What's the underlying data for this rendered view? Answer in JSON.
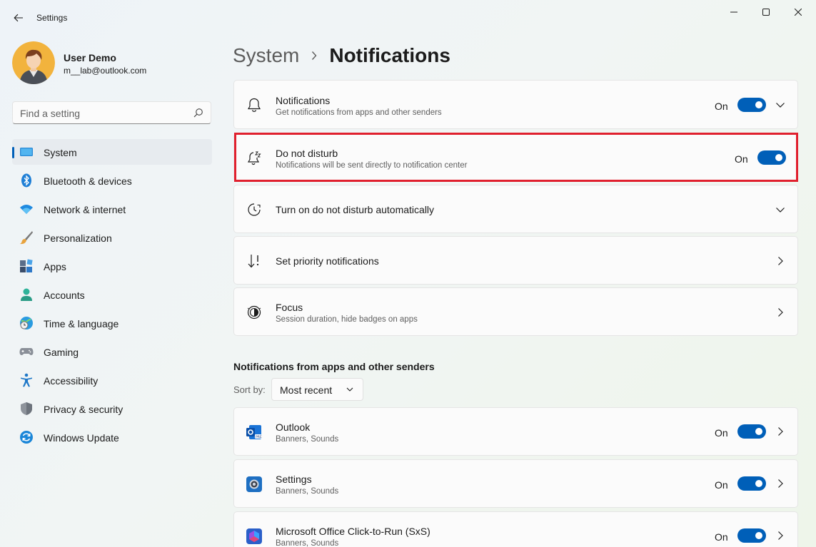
{
  "window": {
    "title": "Settings"
  },
  "profile": {
    "name": "User Demo",
    "email": "m__lab@outlook.com"
  },
  "search": {
    "placeholder": "Find a setting"
  },
  "sidebar": {
    "items": [
      {
        "label": "System",
        "icon": "system-icon",
        "selected": true
      },
      {
        "label": "Bluetooth & devices",
        "icon": "bluetooth-icon"
      },
      {
        "label": "Network & internet",
        "icon": "wifi-icon"
      },
      {
        "label": "Personalization",
        "icon": "brush-icon"
      },
      {
        "label": "Apps",
        "icon": "apps-icon"
      },
      {
        "label": "Accounts",
        "icon": "account-icon"
      },
      {
        "label": "Time & language",
        "icon": "globe-clock-icon"
      },
      {
        "label": "Gaming",
        "icon": "gamepad-icon"
      },
      {
        "label": "Accessibility",
        "icon": "accessibility-icon"
      },
      {
        "label": "Privacy & security",
        "icon": "shield-icon"
      },
      {
        "label": "Windows Update",
        "icon": "update-icon"
      }
    ]
  },
  "breadcrumb": {
    "parent": "System",
    "current": "Notifications"
  },
  "settings": {
    "notifications": {
      "title": "Notifications",
      "subtitle": "Get notifications from apps and other senders",
      "state": "On"
    },
    "dnd": {
      "title": "Do not disturb",
      "subtitle": "Notifications will be sent directly to notification center",
      "state": "On"
    },
    "dnd_auto": {
      "title": "Turn on do not disturb automatically"
    },
    "priority": {
      "title": "Set priority notifications"
    },
    "focus": {
      "title": "Focus",
      "subtitle": "Session duration, hide badges on apps"
    }
  },
  "apps_section": {
    "title": "Notifications from apps and other senders",
    "sort_label": "Sort by:",
    "sort_value": "Most recent",
    "apps": [
      {
        "name": "Outlook",
        "detail": "Banners, Sounds",
        "state": "On",
        "icon": "outlook-icon"
      },
      {
        "name": "Settings",
        "detail": "Banners, Sounds",
        "state": "On",
        "icon": "settings-app-icon"
      },
      {
        "name": "Microsoft Office Click-to-Run (SxS)",
        "detail": "Banners, Sounds",
        "state": "On",
        "icon": "office-icon"
      }
    ]
  },
  "colors": {
    "accent": "#005fb8",
    "highlight": "#e0202e"
  }
}
